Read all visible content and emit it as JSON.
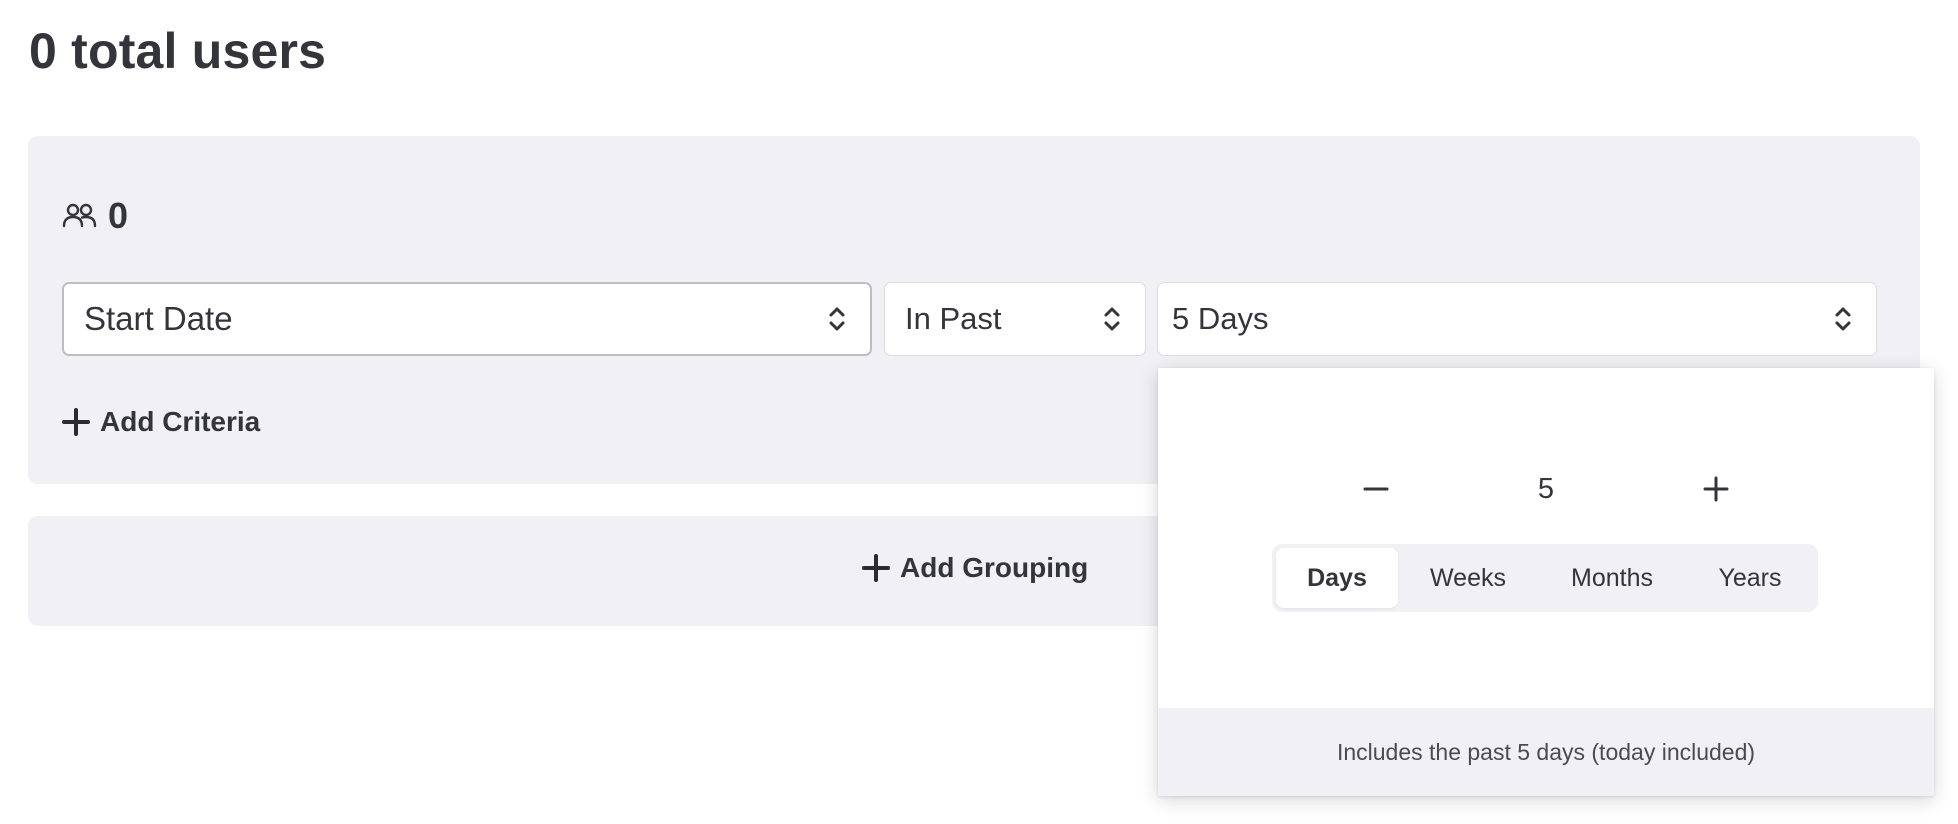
{
  "header": {
    "title": "0 total users"
  },
  "criteria": {
    "count": "0",
    "count_icon": "users-icon",
    "field_select": {
      "value": "Start Date"
    },
    "operator_select": {
      "value": "In Past"
    },
    "value_select": {
      "value": "5 Days"
    },
    "add_criteria_label": "Add Criteria"
  },
  "grouping": {
    "add_grouping_label": "Add Grouping"
  },
  "duration_popover": {
    "amount": "5",
    "minus_icon": "minus-icon",
    "plus_icon": "plus-icon",
    "units": [
      {
        "label": "Days",
        "selected": true
      },
      {
        "label": "Weeks",
        "selected": false
      },
      {
        "label": "Months",
        "selected": false
      },
      {
        "label": "Years",
        "selected": false
      }
    ],
    "summary": "Includes the past 5 days (today included)"
  },
  "colors": {
    "panel_bg": "#f0f0f5",
    "text": "#34343b"
  }
}
